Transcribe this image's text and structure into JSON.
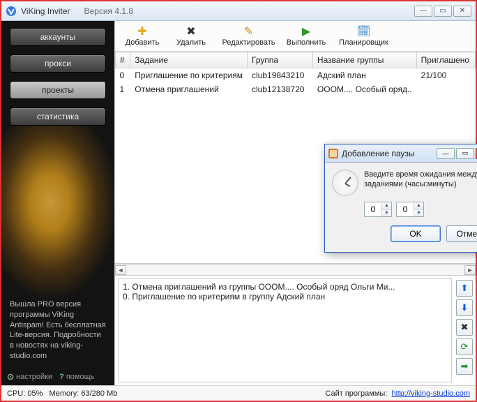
{
  "titlebar": {
    "appname": "ViKing Inviter",
    "version": "Версия 4.1.8"
  },
  "sidebar": {
    "buttons": {
      "accounts": "аккаунты",
      "proxy": "прокси",
      "projects": "проекты",
      "stats": "статистика"
    },
    "promo": "Вышла PRO версия программы ViKing Antispam! Есть бесплатная Lite-версия. Подробности в новостях на viking-studio.com",
    "footer": {
      "settings": "настройки",
      "help": "помощь"
    }
  },
  "toolbar": {
    "add": "Добавить",
    "delete": "Удалить",
    "edit": "Редактировать",
    "run": "Выполнить",
    "scheduler": "Планировщик"
  },
  "table": {
    "headers": {
      "idx": "#",
      "task": "Задание",
      "group": "Группа",
      "groupname": "Название группы",
      "invited": "Приглашено"
    },
    "rows": [
      {
        "idx": "0",
        "task": "Приглашение по критериям",
        "group": "club19843210",
        "groupname": "Адский план",
        "invited": "21/100"
      },
      {
        "idx": "1",
        "task": "Отмена приглашений",
        "group": "club12138720",
        "groupname": "ОООМ.... Особый оряд..",
        "invited": ""
      }
    ]
  },
  "log": {
    "lines": [
      "1. Отмена приглашений из группы  ОООМ.... Особый оряд Ольги Ми...",
      "0. Приглашение по критериям в группу  Адский план"
    ]
  },
  "status": {
    "cpu_label": "CPU:",
    "cpu_val": "05%",
    "mem_label": "Memory:",
    "mem_val": "63/280 Mb",
    "site_label": "Сайт программы:",
    "site_url": "http://viking-studio.com"
  },
  "modal": {
    "title": "Добавление паузы",
    "desc": "Введите время ожидания между заданиями (часы:минуты)",
    "hours": "0",
    "minutes": "0",
    "ok": "OK",
    "cancel": "Отмена"
  }
}
